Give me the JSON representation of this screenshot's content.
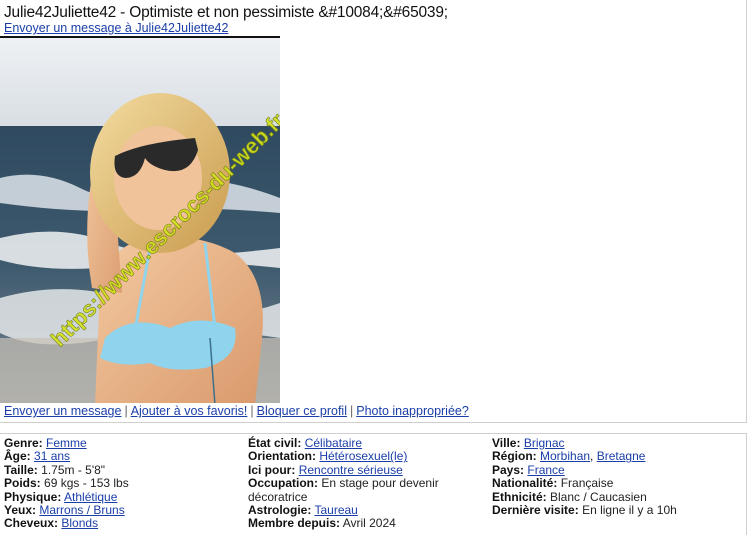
{
  "profile": {
    "title": "Julie42Juliette42 - Optimiste et non pessimiste &#10084;&#65039;",
    "send_message_link": "Envoyer un message à Julie42Juliette42",
    "watermark": "https://www.escrocs-du-web.fr"
  },
  "actions": {
    "send_message": "Envoyer un message",
    "add_favorites": "Ajouter à vos favoris!",
    "block": "Bloquer ce profil",
    "report_photo": "Photo inappropriée?"
  },
  "details": {
    "col1": [
      {
        "label": "Genre:",
        "value": "Femme",
        "link": true
      },
      {
        "label": "Âge:",
        "value": "31 ans",
        "link": true
      },
      {
        "label": "Taille:",
        "value": "1.75m - 5'8\"",
        "link": false
      },
      {
        "label": "Poids:",
        "value": "69 kgs - 153 lbs",
        "link": false
      },
      {
        "label": "Physique:",
        "value": "Athlétique",
        "link": true
      },
      {
        "label": "Yeux:",
        "value": "Marrons / Bruns",
        "link": true
      },
      {
        "label": "Cheveux:",
        "value": "Blonds",
        "link": true
      }
    ],
    "col2": [
      {
        "label": "État civil:",
        "value": "Célibataire",
        "link": true
      },
      {
        "label": "Orientation:",
        "value": "Hétérosexuel(le)",
        "link": true
      },
      {
        "label": "Ici pour:",
        "value": "Rencontre sérieuse",
        "link": true
      },
      {
        "label": "Occupation:",
        "value": "En stage pour devenir décoratrice",
        "link": false
      },
      {
        "label": "Astrologie:",
        "value": "Taureau",
        "link": true
      },
      {
        "label": "Membre depuis:",
        "value": "Avril 2024",
        "link": false
      }
    ],
    "col3": [
      {
        "label": "Ville:",
        "value": "Brignac",
        "link": true
      },
      {
        "label": "Région:",
        "value": "Morbihan",
        "value2": "Bretagne",
        "link": true
      },
      {
        "label": "Pays:",
        "value": "France",
        "link": true
      },
      {
        "label": "Nationalité:",
        "value": "Française",
        "link": false
      },
      {
        "label": "Ethnicité:",
        "value": "Blanc / Caucasien",
        "link": false
      },
      {
        "label": "Dernière visite:",
        "value": "En ligne il y a 10h",
        "link": false
      }
    ]
  }
}
